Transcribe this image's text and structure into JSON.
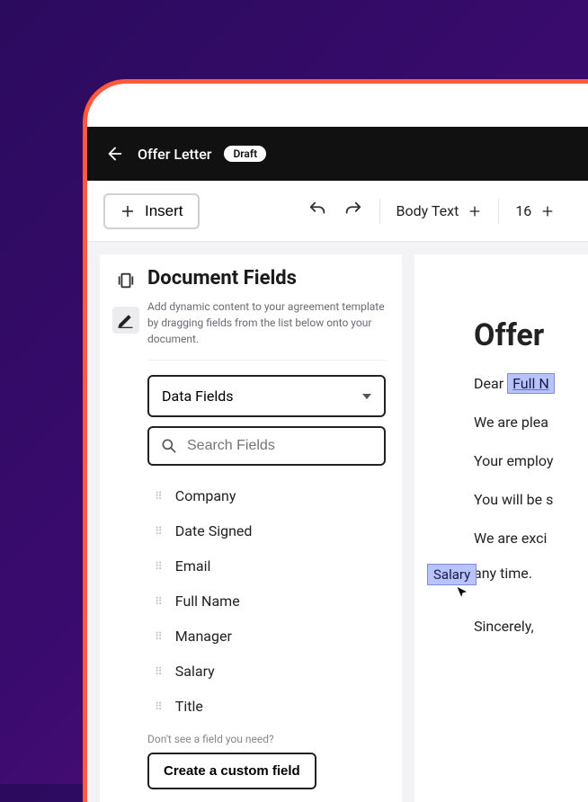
{
  "header": {
    "title": "Offer Letter",
    "badge": "Draft"
  },
  "toolbar": {
    "insert_label": "Insert",
    "style_label": "Body Text",
    "font_size": "16"
  },
  "panel": {
    "title": "Document Fields",
    "description": "Add dynamic content to your agreement template by dragging fields from the list below onto your document.",
    "dropdown_label": "Data Fields",
    "search_placeholder": "Search Fields",
    "fields": [
      "Company",
      "Date Signed",
      "Email",
      "Full Name",
      "Manager",
      "Salary",
      "Title"
    ],
    "hint": "Don't see a field you need?",
    "custom_button": "Create a custom field"
  },
  "document": {
    "heading_visible": "Offer",
    "greeting_prefix": "Dear ",
    "greeting_token": "Full N",
    "line2": "We are plea",
    "line3": "Your employ",
    "line4": "You will be s",
    "line5a": "We are exci",
    "line5b": "any time.",
    "signoff": "Sincerely,",
    "dragging_token": "Salary"
  }
}
